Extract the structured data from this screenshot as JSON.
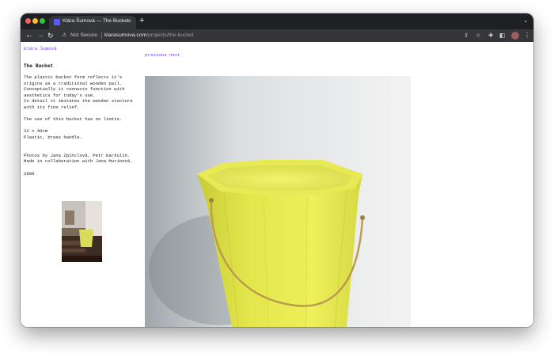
{
  "browser": {
    "tab_title": "Klára Šumová — The Bucket",
    "security_label": "Not Secure",
    "url_host": "klarasumova.com",
    "url_path": "/projects/the-bucket",
    "icons": [
      "back-icon",
      "forward-icon",
      "reload-icon",
      "warning-icon",
      "share-icon",
      "star-icon",
      "extensions-icon",
      "sidebar-icon",
      "profile-avatar",
      "menu-icon"
    ]
  },
  "page": {
    "author_link": "Klára Šumová",
    "nav": {
      "previous": "previous",
      "next": "next"
    },
    "title": "The Bucket",
    "description": {
      "line1": "The plastic bucket form reflects it's",
      "line2": "origins as a traditional wooden pail.",
      "line3": "Conceptually it connects function with",
      "line4": "aesthetics for today's use.",
      "line5": "In detail it imitates the wooden stucture",
      "line6": "with its fine relief.",
      "line7": "The use of this bucket has no limits.",
      "line8": "32 x 40cm",
      "line9": "Plastic, brass handle.",
      "line10": "Photos by Jana Zpinclová, Petr Karšulín.",
      "line11": "Made in collaboration with Jana Murínová.",
      "line12": "2008"
    }
  },
  "colors": {
    "link": "#6b42ff",
    "bucket": "#ecec4a",
    "chrome_dark": "#1f2023"
  }
}
